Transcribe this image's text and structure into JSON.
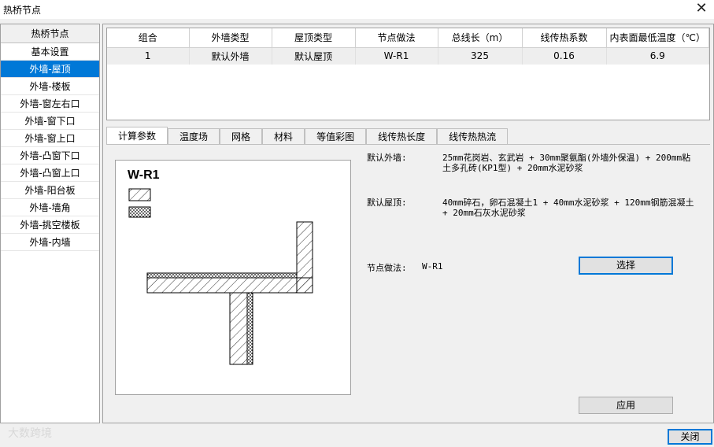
{
  "window": {
    "title": "热桥节点",
    "close_glyph": "✕",
    "close_label": "关闭"
  },
  "sidebar": {
    "header": "热桥节点",
    "items": [
      {
        "label": "基本设置"
      },
      {
        "label": "外墙-屋顶"
      },
      {
        "label": "外墙-楼板"
      },
      {
        "label": "外墙-窗左右口"
      },
      {
        "label": "外墙-窗下口"
      },
      {
        "label": "外墙-窗上口"
      },
      {
        "label": "外墙-凸窗下口"
      },
      {
        "label": "外墙-凸窗上口"
      },
      {
        "label": "外墙-阳台板"
      },
      {
        "label": "外墙-墙角"
      },
      {
        "label": "外墙-挑空楼板"
      },
      {
        "label": "外墙-内墙"
      }
    ],
    "selected_index": 1
  },
  "grid": {
    "columns": [
      "组合",
      "外墙类型",
      "屋顶类型",
      "节点做法",
      "总线长（m）",
      "线传热系数",
      "内表面最低温度（℃）"
    ],
    "rows": [
      [
        "1",
        "默认外墙",
        "默认屋顶",
        "W-R1",
        "325",
        "0.16",
        "6.9"
      ]
    ]
  },
  "tabs": [
    "计算参数",
    "温度场",
    "网格",
    "材料",
    "等值彩图",
    "线传热长度",
    "线传热热流"
  ],
  "active_tab": 0,
  "panel": {
    "drawing_label": "W-R1",
    "wall_label": "默认外墙:",
    "wall_desc_line1": "25mm花岗岩、玄武岩 + 30mm聚氨酯(外墙外保温) + 200mm粘",
    "wall_desc_line2": "土多孔砖(KP1型) + 20mm水泥砂浆",
    "roof_label": "默认屋顶:",
    "roof_desc_line1": "40mm碎石，卵石混凝土1 + 40mm水泥砂浆 + 120mm钢筋混凝土",
    "roof_desc_line2": "+ 20mm石灰水泥砂浆",
    "node_label": "节点做法:",
    "node_value": "W-R1",
    "select_button": "选择",
    "apply_button": "应用"
  },
  "watermark": "大数跨境"
}
